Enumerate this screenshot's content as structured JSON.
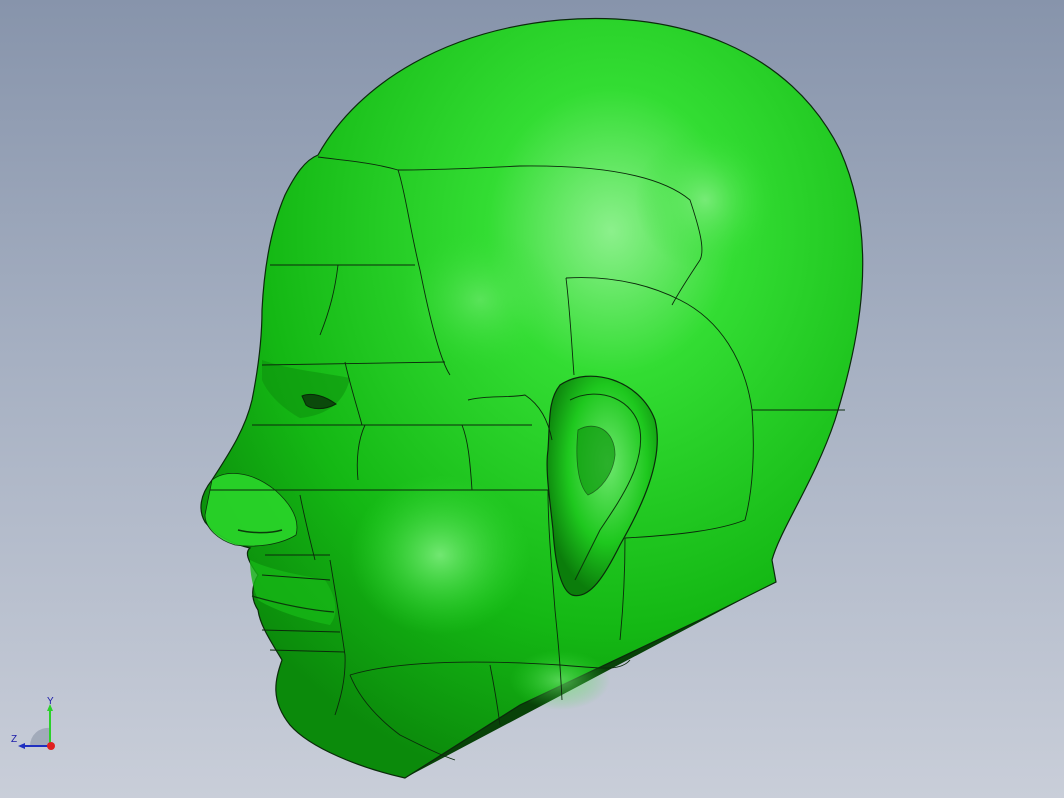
{
  "viewport": {
    "background_top": "#8794ab",
    "background_bottom": "#c9ced9"
  },
  "model": {
    "subject": "head",
    "color": "#1fd41f",
    "highlight": "#8cf08c",
    "shadow": "#0a6a0a",
    "edge_color": "#0b2a0b"
  },
  "triad": {
    "y_label": "Y",
    "z_label": "Z",
    "y_color": "#2bd02b",
    "z_color": "#2030c0",
    "x_color": "#e02020"
  }
}
